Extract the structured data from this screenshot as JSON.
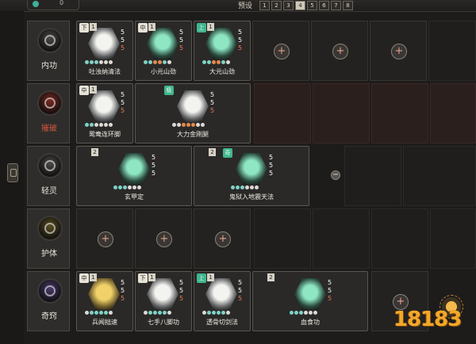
{
  "header": {
    "preset_label": "预设",
    "presets": [
      "1",
      "2",
      "3",
      "4",
      "5",
      "6",
      "7",
      "8"
    ],
    "active_preset": "4"
  },
  "categories": {
    "neigong": "内功",
    "liepo": "摧破",
    "qingling": "轻灵",
    "huti": "护体",
    "qiqiao": "奇窍"
  },
  "rows": {
    "neigong": [
      {
        "name": "吐浊纳清法",
        "tag": "下",
        "level": "1",
        "stats": [
          "5",
          "5",
          "5"
        ],
        "dots": [
          "t",
          "t",
          "t",
          "w",
          "w",
          "w"
        ]
      },
      {
        "name": "小元山劲",
        "tag": "中",
        "level": "1",
        "stats": [
          "5",
          "5",
          "5"
        ],
        "dots": [
          "t",
          "t",
          "o",
          "o",
          "t",
          "w"
        ]
      },
      {
        "name": "大元山劲",
        "tag": "上",
        "level": "1",
        "stats": [
          "5",
          "5",
          "5"
        ],
        "dots": [
          "t",
          "t",
          "o",
          "o",
          "t",
          "w"
        ]
      }
    ],
    "liepo": [
      {
        "name": "鸳鸯连环脚",
        "tag": "中",
        "level": "1",
        "stats": [
          "5",
          "5",
          "5"
        ],
        "dots": [
          "t",
          "t",
          "w",
          "w",
          "w",
          "w"
        ]
      },
      {
        "name": "大力金刚腿",
        "tag": "极",
        "level": "1",
        "stats": [
          "5",
          "5",
          "5"
        ],
        "dots": [
          "w",
          "w",
          "o",
          "o",
          "o",
          "w",
          "w"
        ]
      }
    ],
    "qingling": [
      {
        "name": "玄甲定",
        "tag": "",
        "level": "2",
        "stats": [
          "5",
          "5",
          "5"
        ],
        "dots": [
          "t",
          "t",
          "t",
          "w",
          "w",
          "w"
        ]
      },
      {
        "name": "鬼狱入地震天法",
        "tag": "奇",
        "level": "2",
        "stats": [
          "5",
          "5",
          "5"
        ],
        "dots": [
          "t",
          "t",
          "t",
          "w",
          "w",
          "w"
        ]
      }
    ],
    "qiqiao": [
      {
        "name": "兵闻拙速",
        "tag": "中",
        "level": "1",
        "stats": [
          "5",
          "5",
          "5"
        ],
        "dots": [
          "w",
          "t",
          "t",
          "t",
          "t",
          "w"
        ]
      },
      {
        "name": "七手八脚功",
        "tag": "下",
        "level": "1",
        "stats": [
          "5",
          "5",
          "5"
        ],
        "dots": [
          "w",
          "t",
          "t",
          "t",
          "t",
          "w"
        ]
      },
      {
        "name": "透骨切剑法",
        "tag": "上",
        "level": "1",
        "stats": [
          "5",
          "5",
          "5"
        ],
        "dots": [
          "w",
          "t",
          "t",
          "t",
          "t",
          "w"
        ]
      },
      {
        "name": "血食功",
        "tag": "",
        "level": "2",
        "stats": [
          "5",
          "5",
          "5"
        ],
        "dots": [
          "t",
          "t",
          "t",
          "w",
          "w",
          "w"
        ]
      }
    ]
  },
  "add_symbol": "+",
  "remove_symbol": "−",
  "watermark": "18183",
  "colors": {
    "accent": "#e4894e",
    "teal": "#7fd2c5",
    "jade": "#8ee6c3",
    "red_label": "#d4573e",
    "watermark": "#f4a82a"
  }
}
